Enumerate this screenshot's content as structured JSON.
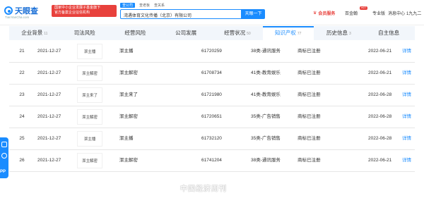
{
  "header": {
    "logo_text": "天眼查",
    "logo_url": "TianYanCha.com",
    "promo_line1": "国家中小企业发展子基金旗下",
    "promo_line2": "官方备案企业征信机构",
    "search_tabs": [
      "查公司",
      "查老板",
      "查关系"
    ],
    "search_value": "湾遇体育文化传播（北京）有限公司",
    "search_button": "天眼一下",
    "nav_vip": "会员服务",
    "nav_baijin": "百金翰",
    "nav_pro": "专业版",
    "nav_msg": "消息中心",
    "nav_user": "1九九二",
    "hot_badge": "HOT"
  },
  "tabs": [
    {
      "label": "企业背景",
      "count": "11"
    },
    {
      "label": "司法风险",
      "count": ""
    },
    {
      "label": "经营风险",
      "count": ""
    },
    {
      "label": "公司发展",
      "count": ""
    },
    {
      "label": "经营状况",
      "count": "50"
    },
    {
      "label": "知识产权",
      "count": "77"
    },
    {
      "label": "历史信息",
      "count": "3"
    },
    {
      "label": "自主信息",
      "count": ""
    }
  ],
  "active_tab": "知识产权",
  "rows": [
    {
      "idx": "21",
      "date": "2021-12-27",
      "img_text": "潔主播",
      "name": "潔主播",
      "reg": "61720259",
      "cls": "38类-通讯服务",
      "status": "商标已注册",
      "date2": "2022-06-21",
      "detail": "详情"
    },
    {
      "idx": "22",
      "date": "2021-12-27",
      "img_text": "潔主解密",
      "name": "潔主解密",
      "reg": "61708734",
      "cls": "41类-教育娱乐",
      "status": "商标已注册",
      "date2": "2022-06-21",
      "detail": "详情"
    },
    {
      "idx": "23",
      "date": "2021-12-27",
      "img_text": "潔主来了",
      "name": "潔主来了",
      "reg": "61721980",
      "cls": "41类-教育娱乐",
      "status": "商标已注册",
      "date2": "2022-06-28",
      "detail": "详情"
    },
    {
      "idx": "24",
      "date": "2021-12-27",
      "img_text": "潔主解密",
      "name": "潔主解密",
      "reg": "61720651",
      "cls": "35类-广告销售",
      "status": "商标已注册",
      "date2": "2022-06-28",
      "detail": "详情"
    },
    {
      "idx": "25",
      "date": "2021-12-27",
      "img_text": "潔主播",
      "name": "潔主播",
      "reg": "61732120",
      "cls": "35类-广告销售",
      "status": "商标已注册",
      "date2": "2022-06-28",
      "detail": "详情"
    },
    {
      "idx": "26",
      "date": "2021-12-27",
      "img_text": "潔主解密",
      "name": "潔主解密",
      "reg": "61741204",
      "cls": "38类-通讯服务",
      "status": "商标已注册",
      "date2": "2022-06-21",
      "detail": "详情"
    }
  ],
  "side_widget_text": "PP",
  "watermark": "中国经济周刊",
  "colors": {
    "accent": "#1a8cff",
    "promo": "#e8413c"
  }
}
